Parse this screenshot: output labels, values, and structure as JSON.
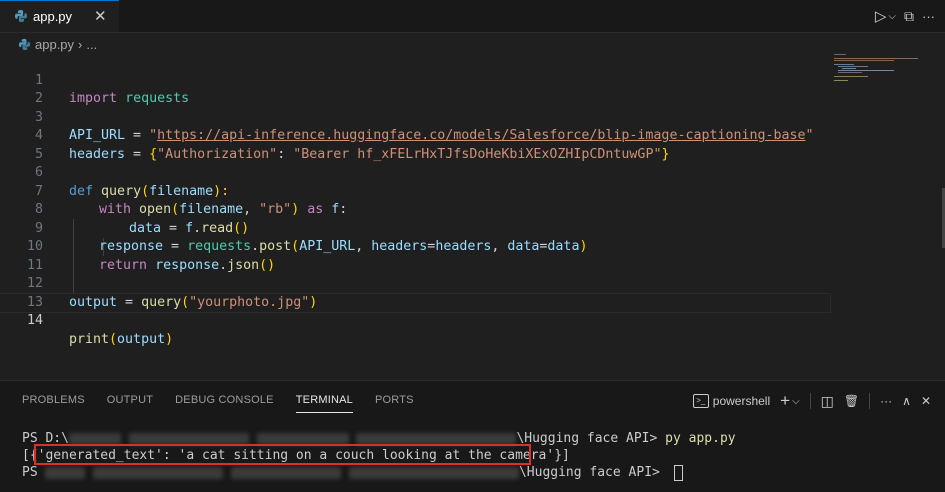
{
  "tab": {
    "filename": "app.py",
    "close": "✕"
  },
  "toolbar": {
    "run_icon": "▷",
    "run_dropdown": "⌵",
    "split_icon": "⧉",
    "more_icon": "···"
  },
  "breadcrumb": {
    "file": "app.py",
    "sep": "›",
    "more": "..."
  },
  "editor": {
    "line_numbers": [
      "1",
      "2",
      "3",
      "4",
      "5",
      "6",
      "7",
      "8",
      "9",
      "10",
      "11",
      "12",
      "13",
      "14"
    ],
    "current_line": "14",
    "lines": {
      "l1": {
        "kw": "import",
        "mod": "requests"
      },
      "l3": {
        "var": "API_URL",
        "eq": " = ",
        "q1": "\"",
        "url": "https://api-inference.huggingface.co/models/Salesforce/blip-image-captioning-base",
        "q2": "\""
      },
      "l4": {
        "var": "headers",
        "eq": " = ",
        "open": "{",
        "key": "\"Authorization\"",
        "colon": ": ",
        "val": "\"Bearer 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\"",
        "close": "}"
      },
      "l6": {
        "def": "def",
        "fn": "query",
        "open": "(",
        "arg": "filename",
        "close": "):"
      },
      "l7": {
        "with": "with",
        "fn": "open",
        "open": "(",
        "arg": "filename",
        "comma": ", ",
        "mode": "\"rb\"",
        "close": ")",
        "as": "as",
        "f": "f",
        "colon": ":"
      },
      "l8": {
        "data": "data",
        "eq": " = ",
        "f": "f",
        "dot": ".",
        "read": "read",
        "paren": "()"
      },
      "l9": {
        "resp": "response",
        "eq": " = ",
        "mod": "requests",
        "dot": ".",
        "post": "post",
        "open": "(",
        "url": "API_URL",
        "c1": ", ",
        "hk": "headers",
        "e1": "=",
        "hv": "headers",
        "c2": ", ",
        "dk": "data",
        "e2": "=",
        "dv": "data",
        "close": ")"
      },
      "l10": {
        "ret": "return",
        "resp": "response",
        "dot": ".",
        "json": "json",
        "paren": "()"
      },
      "l12": {
        "out": "output",
        "eq": " = ",
        "fn": "query",
        "open": "(",
        "arg": "\"yourphoto.jpg\"",
        "close": ")"
      },
      "l14": {
        "fn": "print",
        "open": "(",
        "arg": "output",
        "close": ")"
      }
    }
  },
  "panel": {
    "tabs": [
      "PROBLEMS",
      "OUTPUT",
      "DEBUG CONSOLE",
      "TERMINAL",
      "PORTS"
    ],
    "active_tab": "TERMINAL",
    "shell_label": "powershell",
    "add_icon": "+",
    "dropdown_icon": "⌵",
    "split_icon": "◫",
    "trash_icon": "🗑",
    "more_icon": "···",
    "maximize_icon": "∧",
    "close_icon": "✕"
  },
  "terminal": {
    "line1_prefix": "PS D:\\",
    "line1_suffix": "\\Hugging face API> ",
    "line1_cmd": "py app.py",
    "line2": "[{'generated_text': 'a cat sitting on a couch looking at the camera'}]",
    "line3_prefix": "PS ",
    "line3_suffix": "\\Hugging face API> "
  },
  "colors": {
    "accent": "#0078d4",
    "highlight_box": "#d9302b",
    "string": "#ce9178",
    "keyword": "#c586c0"
  }
}
